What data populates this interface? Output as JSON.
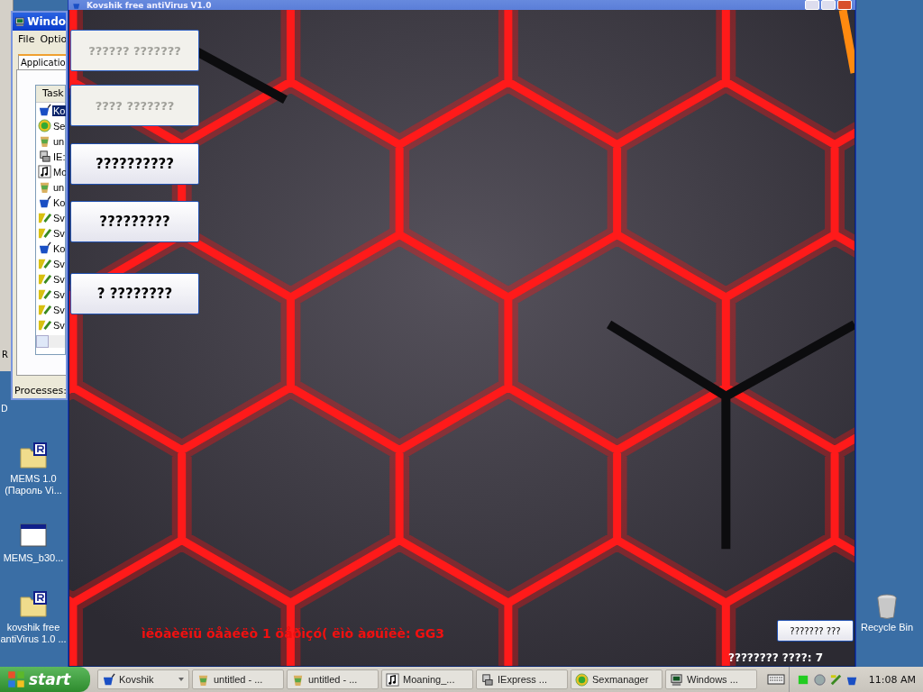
{
  "back_window": {
    "letter": "R"
  },
  "desktop_fragment": "D",
  "task_manager": {
    "title": "Windo",
    "menu": [
      "File",
      "Optio"
    ],
    "tab": "Applicatio",
    "column": "Task",
    "status": "Processes:",
    "rows": [
      {
        "text": "Ko",
        "kind": "cup",
        "selected": true
      },
      {
        "text": "Se",
        "kind": "smiley",
        "selected": false
      },
      {
        "text": "un",
        "kind": "paint",
        "selected": false
      },
      {
        "text": "IE:",
        "kind": "setup",
        "selected": false
      },
      {
        "text": "Mo",
        "kind": "music",
        "selected": false
      },
      {
        "text": "un",
        "kind": "paint",
        "selected": false
      },
      {
        "text": "Ko",
        "kind": "cup",
        "selected": false
      },
      {
        "text": "Sv",
        "kind": "tool",
        "selected": false
      },
      {
        "text": "Sv",
        "kind": "tool",
        "selected": false
      },
      {
        "text": "Ko",
        "kind": "cup",
        "selected": false
      },
      {
        "text": "Sv",
        "kind": "tool",
        "selected": false
      },
      {
        "text": "Sv",
        "kind": "tool",
        "selected": false
      },
      {
        "text": "Sv",
        "kind": "tool",
        "selected": false
      },
      {
        "text": "Sv",
        "kind": "tool",
        "selected": false
      },
      {
        "text": "Sv",
        "kind": "tool",
        "selected": false
      }
    ]
  },
  "desktop_icons": [
    {
      "lines": [
        "MEMS 1.0",
        "(Пароль Vi..."
      ],
      "kind": "archive"
    },
    {
      "lines": [
        "MEMS_b30..."
      ],
      "kind": "program"
    },
    {
      "lines": [
        "kovshik free",
        "antiVirus 1.0 ..."
      ],
      "kind": "archive"
    }
  ],
  "recycle_bin": {
    "label": "Recycle Bin"
  },
  "app_window": {
    "title": "Kovshik free antiVirus V1.0",
    "buttons": [
      {
        "label": "?????? ???????",
        "disabled": true
      },
      {
        "label": "???? ???????",
        "disabled": true
      },
      {
        "label": "??????????",
        "disabled": false
      },
      {
        "label": "?????????",
        "disabled": false
      },
      {
        "label": "? ????????",
        "disabled": false
      }
    ],
    "message": "ìëöàèëïü öåàéëò 1 öåðìçó( ëìò àøüîëè: GG3",
    "action_button": "??????? ???",
    "status": "???????? ????: 7"
  },
  "taskbar": {
    "start": "start",
    "clock": "11:08 AM",
    "items": [
      {
        "label": "Kovshik",
        "kind": "cup",
        "grouped": true
      },
      {
        "label": "untitled - ...",
        "kind": "paint",
        "grouped": false
      },
      {
        "label": "untitled - ...",
        "kind": "paint",
        "grouped": false
      },
      {
        "label": "Moaning_...",
        "kind": "music",
        "grouped": false
      },
      {
        "label": "IExpress ...",
        "kind": "setup",
        "grouped": false
      },
      {
        "label": "Sexmanager",
        "kind": "smiley",
        "grouped": false
      },
      {
        "label": "Windows ...",
        "kind": "monitor",
        "grouped": false
      }
    ]
  }
}
